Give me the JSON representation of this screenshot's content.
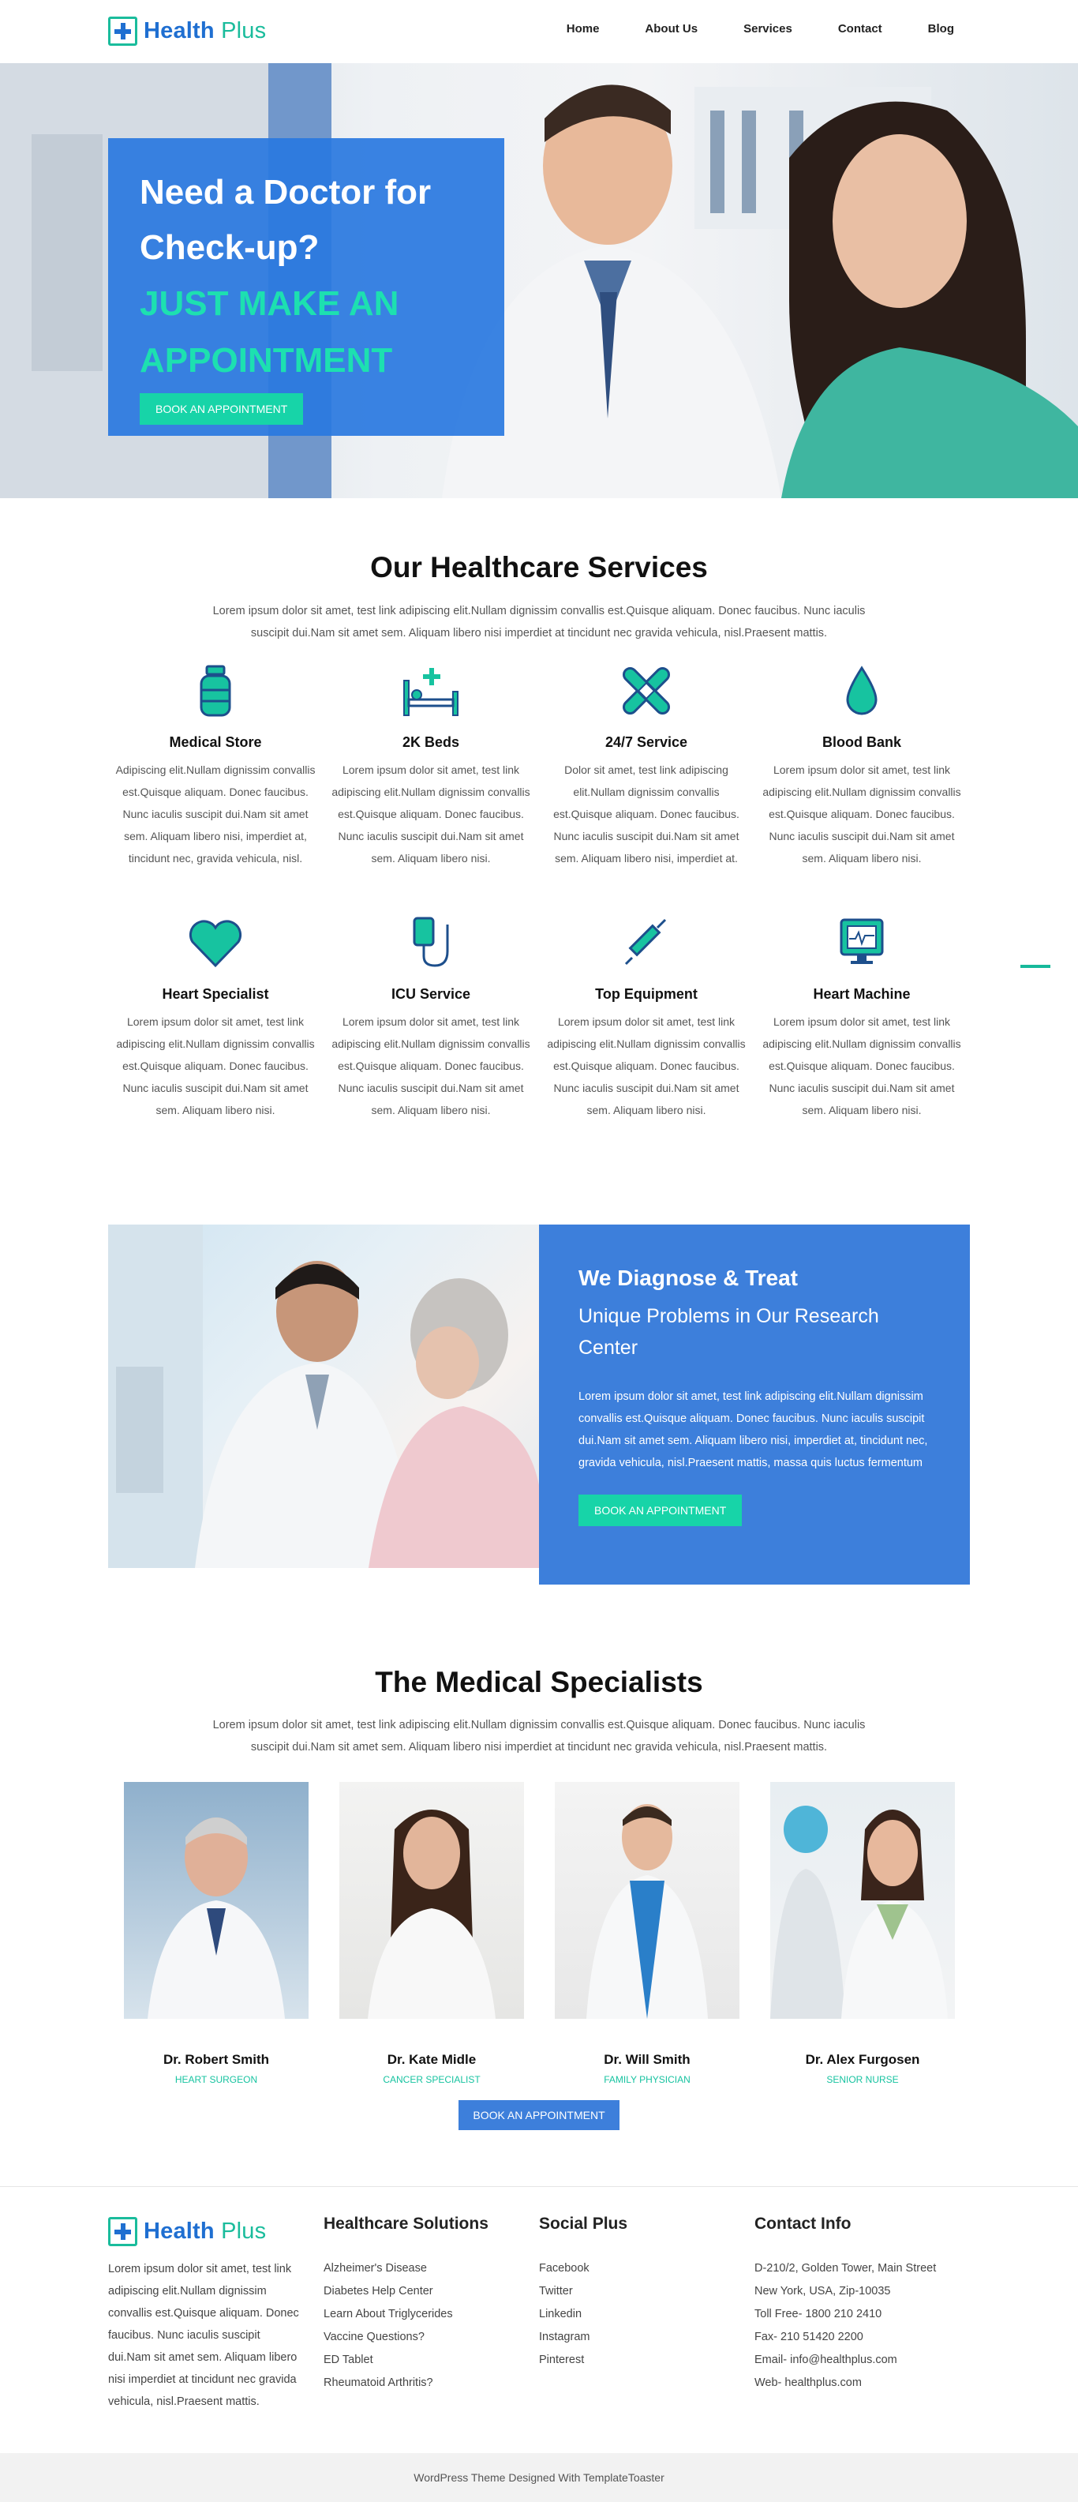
{
  "header": {
    "logo": {
      "part1": "Health",
      "part2": "Plus"
    },
    "nav": [
      "Home",
      "About Us",
      "Services",
      "Contact",
      "Blog"
    ]
  },
  "hero": {
    "line1": "Need a Doctor for",
    "line2": "Check-up?",
    "line3": "JUST MAKE AN",
    "line4": "APPOINTMENT",
    "button": "BOOK AN APPOINTMENT"
  },
  "services": {
    "title": "Our Healthcare Services",
    "subtitle": "Lorem ipsum dolor sit amet, test link adipiscing elit.Nullam dignissim convallis est.Quisque aliquam. Donec faucibus. Nunc iaculis suscipit dui.Nam sit amet sem. Aliquam libero nisi imperdiet at tincidunt nec gravida vehicula, nisl.Praesent mattis.",
    "items": [
      {
        "icon": "medicine-bottle-icon",
        "name": "Medical Store",
        "text": "Adipiscing elit.Nullam dignissim convallis est.Quisque aliquam. Donec faucibus. Nunc iaculis suscipit dui.Nam sit amet sem. Aliquam libero nisi, imperdiet at, tincidunt nec, gravida vehicula, nisl."
      },
      {
        "icon": "hospital-bed-icon",
        "name": "2K Beds",
        "text": "Lorem ipsum dolor sit amet, test link adipiscing elit.Nullam dignissim convallis est.Quisque aliquam. Donec faucibus. Nunc iaculis suscipit dui.Nam sit amet sem. Aliquam libero nisi."
      },
      {
        "icon": "bandage-icon",
        "name": "24/7 Service",
        "text": "Dolor sit amet, test link adipiscing elit.Nullam dignissim convallis est.Quisque aliquam. Donec faucibus. Nunc iaculis suscipit dui.Nam sit amet sem. Aliquam libero nisi, imperdiet at."
      },
      {
        "icon": "blood-drop-icon",
        "name": "Blood Bank",
        "text": "Lorem ipsum dolor sit amet, test link adipiscing elit.Nullam dignissim convallis est.Quisque aliquam. Donec faucibus. Nunc iaculis suscipit dui.Nam sit amet sem. Aliquam libero nisi."
      },
      {
        "icon": "heart-icon",
        "name": "Heart Specialist",
        "text": "Lorem ipsum dolor sit amet, test link adipiscing elit.Nullam dignissim convallis est.Quisque aliquam. Donec faucibus. Nunc iaculis suscipit dui.Nam sit amet sem. Aliquam libero nisi."
      },
      {
        "icon": "iv-bag-icon",
        "name": "ICU Service",
        "text": "Lorem ipsum dolor sit amet, test link adipiscing elit.Nullam dignissim convallis est.Quisque aliquam. Donec faucibus. Nunc iaculis suscipit dui.Nam sit amet sem. Aliquam libero nisi."
      },
      {
        "icon": "syringe-icon",
        "name": "Top Equipment",
        "text": "Lorem ipsum dolor sit amet, test link adipiscing elit.Nullam dignissim convallis est.Quisque aliquam. Donec faucibus. Nunc iaculis suscipit dui.Nam sit amet sem. Aliquam libero nisi."
      },
      {
        "icon": "heart-monitor-icon",
        "name": "Heart Machine",
        "text": "Lorem ipsum dolor sit amet, test link adipiscing elit.Nullam dignissim convallis est.Quisque aliquam. Donec faucibus. Nunc iaculis suscipit dui.Nam sit amet sem. Aliquam libero nisi."
      }
    ]
  },
  "diagnose": {
    "title": "We Diagnose & Treat",
    "subtitle": "Unique Problems in Our Research Center",
    "text": "Lorem ipsum dolor sit amet, test link adipiscing elit.Nullam dignissim convallis est.Quisque aliquam. Donec faucibus. Nunc iaculis suscipit dui.Nam sit amet sem. Aliquam libero nisi, imperdiet at, tincidunt nec, gravida vehicula, nisl.Praesent mattis, massa quis luctus fermentum",
    "button": "BOOK AN APPOINTMENT"
  },
  "specialists": {
    "title": "The Medical Specialists",
    "subtitle": "Lorem ipsum dolor sit amet, test link adipiscing elit.Nullam dignissim convallis est.Quisque aliquam. Donec faucibus. Nunc iaculis suscipit dui.Nam sit amet sem. Aliquam libero nisi imperdiet at tincidunt nec gravida vehicula, nisl.Praesent mattis.",
    "doctors": [
      {
        "name": "Dr. Robert Smith",
        "role": "HEART SURGEON"
      },
      {
        "name": "Dr. Kate Midle",
        "role": "CANCER SPECIALIST"
      },
      {
        "name": "Dr. Will Smith",
        "role": "FAMILY PHYSICIAN"
      },
      {
        "name": "Dr. Alex Furgosen",
        "role": "SENIOR NURSE"
      }
    ],
    "button": "BOOK AN APPOINTMENT"
  },
  "footer": {
    "about": "Lorem ipsum dolor sit amet, test link adipiscing elit.Nullam dignissim convallis est.Quisque aliquam. Donec faucibus. Nunc iaculis suscipit dui.Nam sit amet sem. Aliquam libero nisi imperdiet at tincidunt nec gravida vehicula, nisl.Praesent mattis.",
    "solutions": {
      "title": "Healthcare Solutions",
      "links": [
        "Alzheimer's Disease",
        "Diabetes Help Center",
        "Learn About Triglycerides",
        "Vaccine Questions?",
        "ED Tablet",
        "Rheumatoid Arthritis?"
      ]
    },
    "social": {
      "title": "Social Plus",
      "links": [
        "Facebook",
        "Twitter",
        "Linkedin",
        "Instagram",
        "Pinterest"
      ]
    },
    "contact": {
      "title": "Contact Info",
      "lines": [
        "D-210/2, Golden Tower, Main Street",
        "New York, USA, Zip-10035",
        "Toll Free- 1800 210 2410",
        "Fax- 210 51420 2200",
        "Email- info@healthplus.com",
        "Web- healthplus.com"
      ]
    },
    "credit": "WordPress Theme Designed With TemplateToaster"
  },
  "colors": {
    "brand_blue": "#1f6fd1",
    "panel_blue": "#3d7fdb",
    "teal": "#17d4a8"
  }
}
